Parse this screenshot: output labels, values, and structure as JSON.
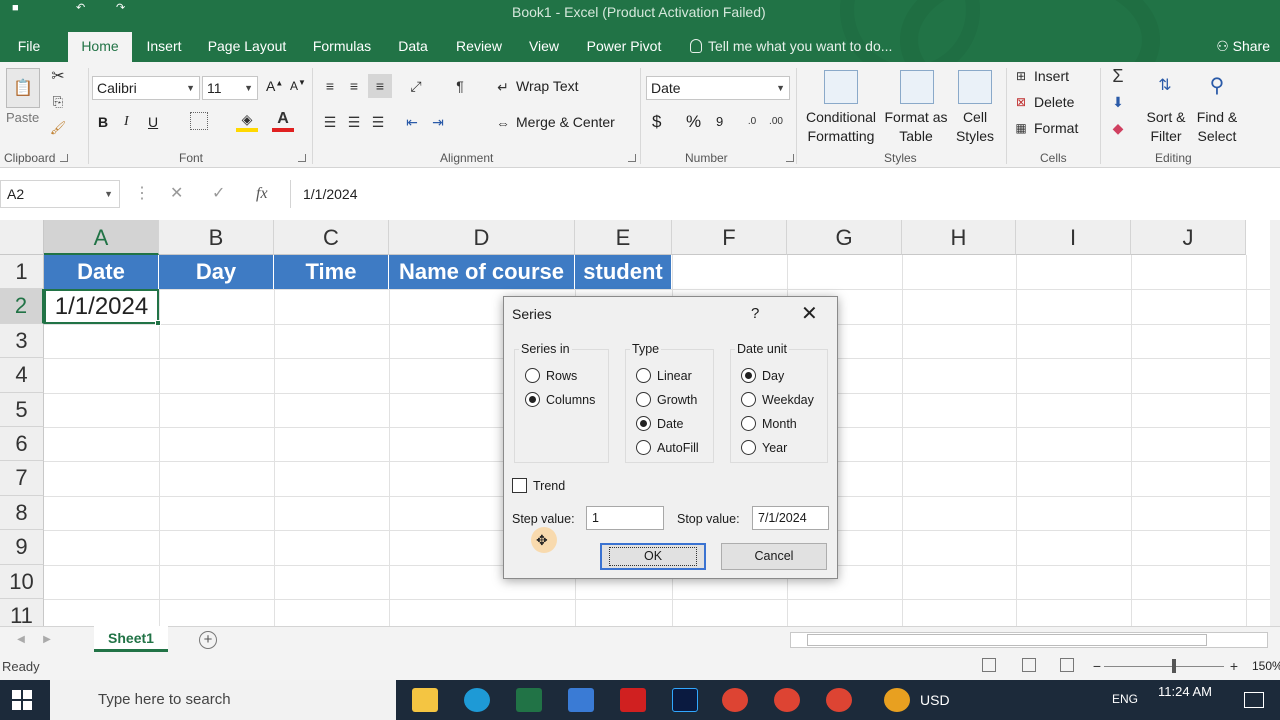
{
  "window": {
    "title": "Book1 - Excel (Product Activation Failed)"
  },
  "ribbon_tabs": [
    "File",
    "Home",
    "Insert",
    "Page Layout",
    "Formulas",
    "Data",
    "Review",
    "View",
    "Power Pivot"
  ],
  "tellme": "Tell me what you want to do...",
  "share": "Share",
  "clipboard": {
    "paste": "Paste",
    "label": "Clipboard"
  },
  "font": {
    "name": "Calibri",
    "size": "11",
    "label": "Font",
    "bold": "B",
    "italic": "I",
    "underline": "U"
  },
  "alignment": {
    "wrap": "Wrap Text",
    "merge": "Merge & Center",
    "label": "Alignment"
  },
  "number": {
    "format": "Date",
    "label": "Number",
    "currency": "$",
    "percent": "%",
    "comma": "9"
  },
  "styles": {
    "conditional": [
      "Conditional",
      "Formatting"
    ],
    "format_table": [
      "Format as",
      "Table"
    ],
    "cell_styles": [
      "Cell",
      "Styles"
    ],
    "label": "Styles"
  },
  "cells": {
    "insert": "Insert",
    "delete": "Delete",
    "format": "Format",
    "label": "Cells"
  },
  "editing": {
    "sort": [
      "Sort &",
      "Filter"
    ],
    "find": [
      "Find &",
      "Select"
    ],
    "label": "Editing"
  },
  "formula_bar": {
    "name_box": "A2",
    "fx": "fx",
    "content": "1/1/2024"
  },
  "columns": [
    "A",
    "B",
    "C",
    "D",
    "E",
    "F",
    "G",
    "H",
    "I",
    "J"
  ],
  "rows": [
    "1",
    "2",
    "3",
    "4",
    "5",
    "6",
    "7",
    "8",
    "9",
    "10",
    "11"
  ],
  "headers": [
    "Date",
    "Day",
    "Time",
    "Name of course",
    "student"
  ],
  "cell_a2": "1/1/2024",
  "sheet_tab": "Sheet1",
  "add_sheet": "+",
  "status": {
    "ready": "Ready",
    "zoom": "150%"
  },
  "taskbar": {
    "search": "Type here to search",
    "currency": "USD",
    "lang": "ENG",
    "time": "11:24 AM"
  },
  "dialog": {
    "title": "Series",
    "help": "?",
    "close": "✕",
    "series_in": {
      "label": "Series in",
      "options": [
        "Rows",
        "Columns"
      ],
      "selected": "Columns"
    },
    "type": {
      "label": "Type",
      "options": [
        "Linear",
        "Growth",
        "Date",
        "AutoFill"
      ],
      "selected": "Date"
    },
    "date_unit": {
      "label": "Date unit",
      "options": [
        "Day",
        "Weekday",
        "Month",
        "Year"
      ],
      "selected": "Day"
    },
    "trend": "Trend",
    "step_label": "Step value:",
    "step_value": "1",
    "stop_label": "Stop value:",
    "stop_value": "7/1/2024",
    "ok": "OK",
    "cancel": "Cancel"
  },
  "colors": {
    "excel_green": "#217346",
    "header_blue": "#3e7bc4"
  }
}
